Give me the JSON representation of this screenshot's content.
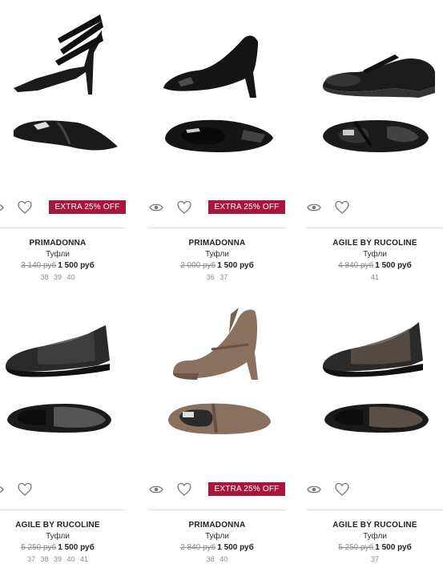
{
  "products": [
    {
      "brand": "PRIMADONNA",
      "category": "Туфли",
      "old_price": "3 140 руб",
      "new_price": "1 500 руб",
      "sizes": "38 39 40",
      "promo": "EXTRA 25% OFF"
    },
    {
      "brand": "PRIMADONNA",
      "category": "Туфли",
      "old_price": "2 000 руб",
      "new_price": "1 500 руб",
      "sizes": "36 37",
      "promo": "EXTRA 25% OFF"
    },
    {
      "brand": "AGILE BY RUCOLINE",
      "category": "Туфли",
      "old_price": "4 840 руб",
      "new_price": "1 500 руб",
      "sizes": "41",
      "promo": ""
    },
    {
      "brand": "AGILE BY RUCOLINE",
      "category": "Туфли",
      "old_price": "5 250 руб",
      "new_price": "1 500 руб",
      "sizes": "37 38 39 40 41",
      "promo": ""
    },
    {
      "brand": "PRIMADONNA",
      "category": "Туфли",
      "old_price": "2 840 руб",
      "new_price": "1 500 руб",
      "sizes": "38 40",
      "promo": "EXTRA 25% OFF"
    },
    {
      "brand": "AGILE BY RUCOLINE",
      "category": "Туфли",
      "old_price": "5 250 руб",
      "new_price": "1 500 руб",
      "sizes": "37",
      "promo": ""
    }
  ],
  "icons": {
    "quick_view": "eye-icon",
    "wishlist": "heart-icon"
  },
  "colors": {
    "promo": "#a8173a",
    "old_price": "#8a8a8a",
    "shoe_black": "#1a1a1a",
    "shoe_brown": "#8a705e"
  }
}
